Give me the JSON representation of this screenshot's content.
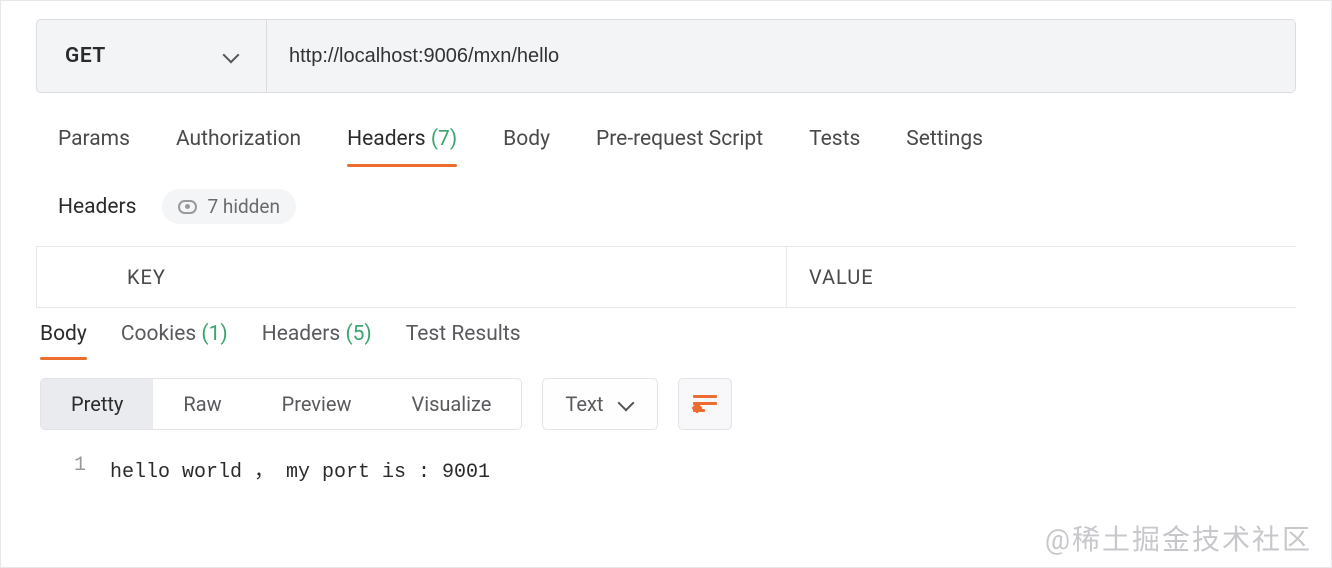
{
  "request": {
    "method": "GET",
    "url": "http://localhost:9006/mxn/hello"
  },
  "tabs": {
    "params": "Params",
    "authorization": "Authorization",
    "headers_label": "Headers",
    "headers_count": "(7)",
    "body": "Body",
    "prerequest": "Pre-request Script",
    "tests": "Tests",
    "settings": "Settings"
  },
  "headers_section": {
    "title": "Headers",
    "hidden_text": "7 hidden",
    "columns": {
      "key": "KEY",
      "value": "VALUE"
    }
  },
  "response_tabs": {
    "body": "Body",
    "cookies_label": "Cookies",
    "cookies_count": "(1)",
    "headers_label": "Headers",
    "headers_count": "(5)",
    "test_results": "Test Results"
  },
  "body_view": {
    "pretty": "Pretty",
    "raw": "Raw",
    "preview": "Preview",
    "visualize": "Visualize",
    "type": "Text"
  },
  "response_body": {
    "lines": [
      {
        "num": "1",
        "text": "hello world ， my port is : 9001"
      }
    ]
  },
  "watermark": "@稀土掘金技术社区"
}
